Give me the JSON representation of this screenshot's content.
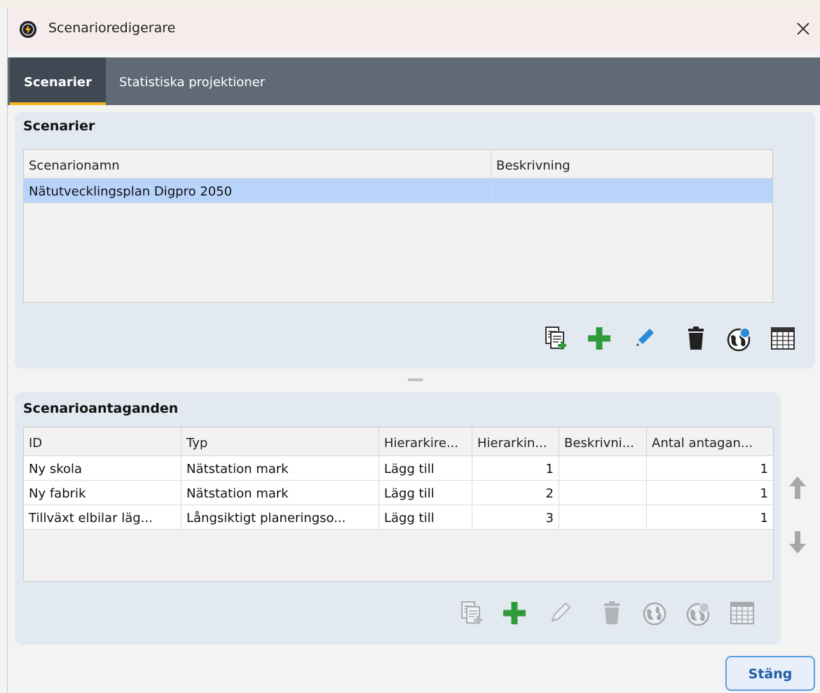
{
  "window": {
    "title": "Scenarioredigerare"
  },
  "tabs": [
    {
      "label": "Scenarier",
      "active": true
    },
    {
      "label": "Statistiska projektioner",
      "active": false
    }
  ],
  "scenarios_panel": {
    "title": "Scenarier",
    "columns": [
      "Scenarionamn",
      "Beskrivning"
    ],
    "rows": [
      {
        "name": "Nätutvecklingsplan Digpro 2050",
        "description": "",
        "selected": true
      }
    ],
    "toolbar_icons": [
      "copy-icon",
      "add-icon",
      "edit-icon",
      "delete-icon",
      "globe-icon",
      "table-icon"
    ]
  },
  "assumptions_panel": {
    "title": "Scenarioantaganden",
    "columns": [
      "ID",
      "Typ",
      "Hierarkire...",
      "Hierarkin...",
      "Beskrivni...",
      "Antal antagan..."
    ],
    "rows": [
      {
        "id": "Ny skola",
        "type": "Nätstation mark",
        "action": "Lägg till",
        "level": "1",
        "description": "",
        "count": "1"
      },
      {
        "id": "Ny fabrik",
        "type": "Nätstation mark",
        "action": "Lägg till",
        "level": "2",
        "description": "",
        "count": "1"
      },
      {
        "id": "Tillväxt elbilar läg...",
        "type": "Långsiktigt planeringso...",
        "action": "Lägg till",
        "level": "3",
        "description": "",
        "count": "1"
      }
    ],
    "toolbar_icons": [
      "copy-icon",
      "add-icon",
      "edit-icon",
      "delete-icon",
      "globe-add-icon",
      "globe-icon",
      "table-icon"
    ],
    "side_icons": [
      "arrow-up-icon",
      "arrow-down-icon"
    ]
  },
  "footer": {
    "close_label": "Stäng"
  },
  "colors": {
    "tabbar": "#606a76",
    "active_tab": "#3f4853",
    "tab_accent": "#f2b51c",
    "panel": "#e3e9f0",
    "selected_row": "#b9d4fb",
    "add_green": "#2e9a3a",
    "edit_blue": "#2a8ad8",
    "button_border": "#5b9ee0"
  }
}
